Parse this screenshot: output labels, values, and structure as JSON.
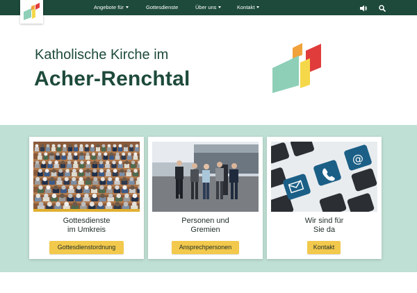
{
  "nav": {
    "items": [
      {
        "label": "Angebote für",
        "dropdown": true
      },
      {
        "label": "Gottesdienste",
        "dropdown": false
      },
      {
        "label": "Über uns",
        "dropdown": true
      },
      {
        "label": "Kontakt",
        "dropdown": true
      }
    ],
    "icons": [
      "speaker-icon",
      "search-icon"
    ]
  },
  "hero": {
    "line1": "Katholische Kirche im",
    "line2": "Acher-Renchtal"
  },
  "cards": [
    {
      "title_line1": "Gottesdienste",
      "title_line2": "im Umkreis",
      "button": "Gottesdienstordnung",
      "image": "church-congregation-photo"
    },
    {
      "title_line1": "Personen und",
      "title_line2": "Gremien",
      "button": "Ansprechpersonen",
      "image": "group-of-people-photo"
    },
    {
      "title_line1": "Wir sind für",
      "title_line2": "Sie da",
      "button": "Kontakt",
      "image": "keyboard-contact-keys-photo"
    }
  ],
  "colors": {
    "nav_bg": "#1d4a3b",
    "band_bg": "#bfe0d4",
    "button_bg": "#f2c94c",
    "logo_red": "#e03c3c",
    "logo_orange": "#f2a23a",
    "logo_yellow": "#f5d84a",
    "logo_green": "#8ecfb8"
  }
}
